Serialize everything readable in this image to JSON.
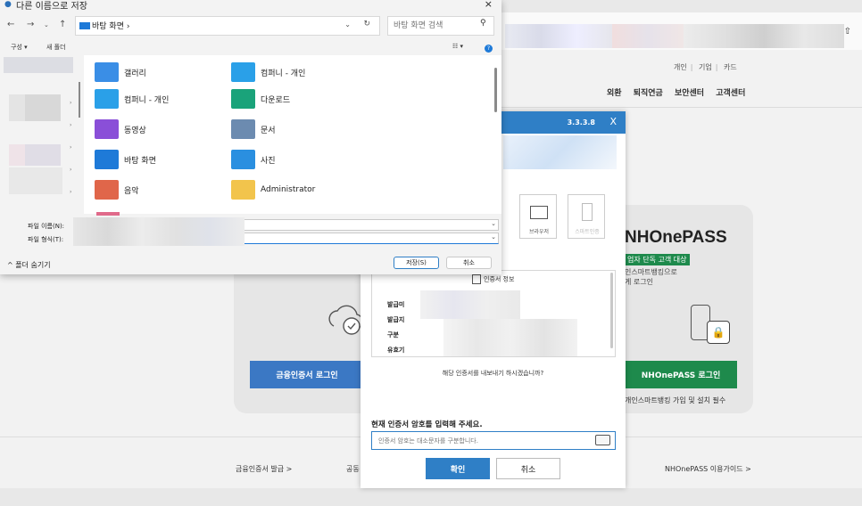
{
  "background_page": {
    "top_links": [
      "개인",
      "기업",
      "카드"
    ],
    "main_nav": [
      "외환",
      "퇴직연금",
      "보안센터",
      "고객센터"
    ],
    "nhpass": {
      "title": "NHOnePASS",
      "badge": "업자 단독 고객 대상",
      "desc_line1": "인스마트뱅킹으로",
      "desc_line2": "게 로그인",
      "button": "NHOnePASS 로그인",
      "footer": "개인스마트뱅킹 가입 및 설치 필수"
    },
    "cert_login_button": "금융인증서 로그인",
    "footer_links": {
      "issue": "금융인증서 발급 >",
      "partial": "공동",
      "guide": "NHOnePASS 이용가이드 >"
    }
  },
  "cert_dialog": {
    "version": "3.3.3.8",
    "close": "X",
    "media": [
      {
        "label": "브라우저",
        "icon": "browser-icon"
      },
      {
        "label": "스마트인증",
        "icon": "smartphone-icon"
      }
    ],
    "info_title": "인증서 정보",
    "rows": [
      "발급미",
      "발급지",
      "구분",
      "유효기"
    ],
    "question": "해당 인증서를 내보내기 하시겠습니까?",
    "password_label": "현재 인증서 암호를 입력해 주세요.",
    "password_placeholder": "인증서 암호는 대소문자를 구분합니다.",
    "ok": "확인",
    "cancel": "취소"
  },
  "save_dialog": {
    "title": "다른 이름으로 저장",
    "close": "×",
    "path": "바탕 화면",
    "path_sep": "›",
    "search_placeholder": "바탕 화면 검색",
    "toolbar": {
      "organize": "구성 ▾",
      "new_folder": "새 폴더"
    },
    "items": [
      {
        "name": "갤러리",
        "icon": "gallery-icon",
        "color": "#3a8ee6"
      },
      {
        "name": "컴퍼니 - 개인",
        "icon": "onedrive-folder-icon",
        "color": "#2aa0e8"
      },
      {
        "name": "컴퍼니 - 개인",
        "icon": "onedrive-folder-icon",
        "color": "#2aa0e8"
      },
      {
        "name": "다운로드",
        "icon": "downloads-icon",
        "color": "#1aa37a"
      },
      {
        "name": "동영상",
        "icon": "videos-icon",
        "color": "#8a4fd8"
      },
      {
        "name": "문서",
        "icon": "documents-icon",
        "color": "#6c8bb0"
      },
      {
        "name": "바탕 화면",
        "icon": "desktop-icon",
        "color": "#1e7ad8"
      },
      {
        "name": "사진",
        "icon": "pictures-icon",
        "color": "#2a8fe0"
      },
      {
        "name": "음악",
        "icon": "music-icon",
        "color": "#e0664a"
      },
      {
        "name": "Administrator",
        "icon": "user-folder-icon",
        "color": "#f2c44c"
      }
    ],
    "filename_label": "파일 이름(N):",
    "filetype_label": "파일 형식(T):",
    "hide_folders": "^ 폴더 숨기기",
    "save": "저장(S)",
    "cancel": "취소"
  }
}
